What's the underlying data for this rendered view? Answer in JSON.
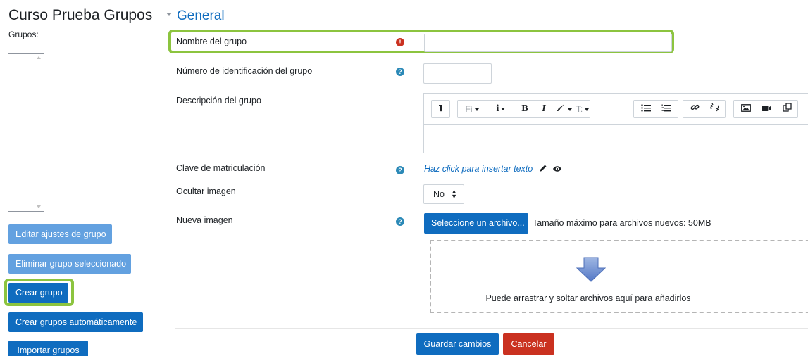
{
  "sidebar": {
    "title": "Curso Prueba  Grupos",
    "groups_label": "Grupos:",
    "buttons": {
      "edit": "Editar ajustes de grupo",
      "delete": "Eliminar grupo seleccionado",
      "create": "Crear grupo",
      "auto": "Crear grupos automáticamente",
      "import": "Importar grupos"
    }
  },
  "form": {
    "section_title": "General",
    "fields": {
      "name": {
        "label": "Nombre del grupo",
        "value": ""
      },
      "idnumber": {
        "label": "Número de identificación del grupo",
        "value": ""
      },
      "description": {
        "label": "Descripción del grupo"
      },
      "enrolkey": {
        "label": "Clave de matriculación",
        "link_text": "Haz click para insertar texto"
      },
      "hidepicture": {
        "label": "Ocultar imagen",
        "value": "No"
      },
      "picture": {
        "label": "Nueva imagen",
        "choose_button": "Seleccione un archivo...",
        "max_size_text": "Tamaño máximo para archivos nuevos: 50MB",
        "drop_text": "Puede arrastrar y soltar archivos aquí para añadirlos"
      }
    },
    "editor_toolbar": {
      "font_label": "Fi",
      "text_style_label": "T:"
    },
    "save_button": "Guardar cambios",
    "cancel_button": "Cancelar"
  },
  "icons": {
    "required": "exclamation-circle-icon",
    "help": "question-circle-icon",
    "edit": "pencil-icon",
    "reveal": "eye-icon",
    "upload": "down-arrow-icon"
  },
  "colors": {
    "primary": "#0f6cbf",
    "primary_light": "#63a1e0",
    "danger": "#ca3120",
    "highlight": "#8cc43f",
    "help_icon": "#2b89b7"
  }
}
